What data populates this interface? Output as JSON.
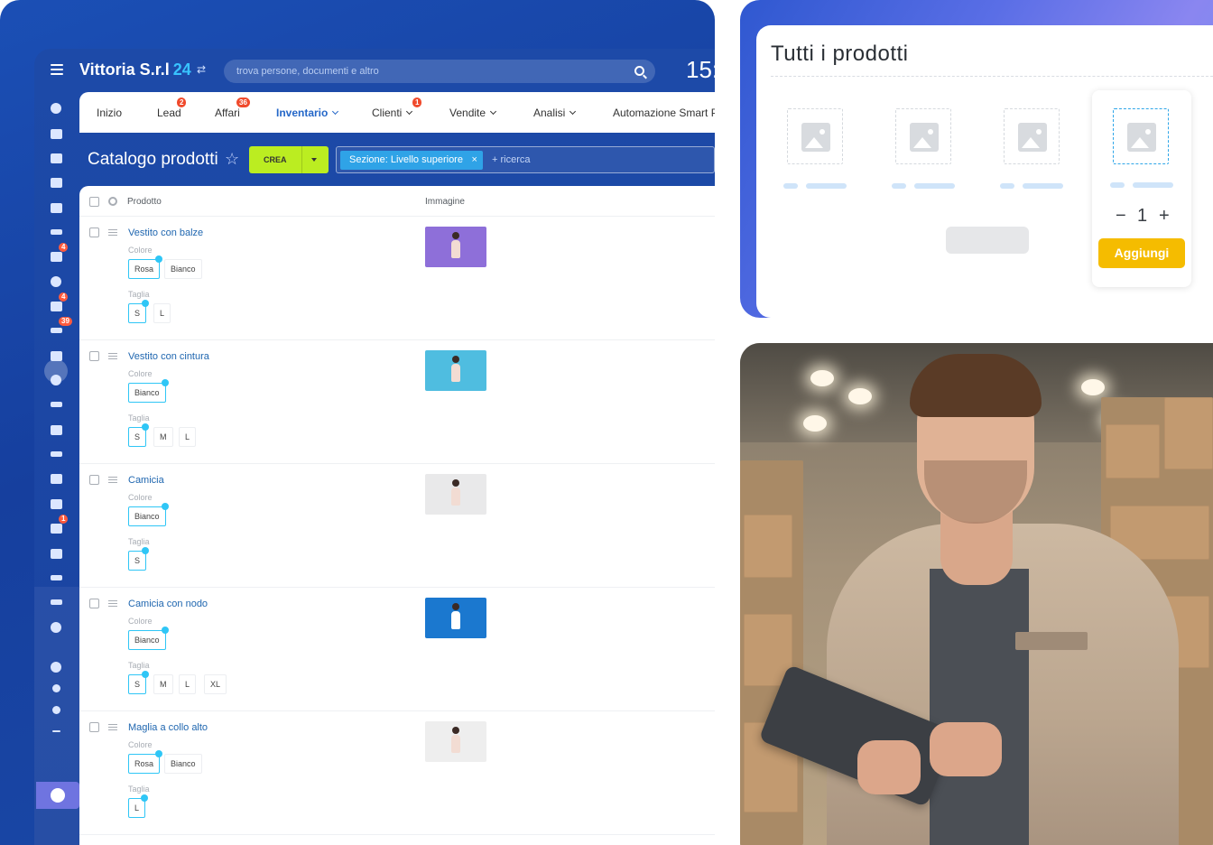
{
  "app": {
    "brand_name": "Vittoria S.r.l",
    "brand_number": "24",
    "brand_toggle": "⇄",
    "search_placeholder": "trova persone, documenti e altro",
    "clock": "15:"
  },
  "sidebar": {
    "icons": [
      "funnel-icon",
      "feed-icon",
      "chat-icon",
      "calendar-icon",
      "document-icon",
      "drive-icon",
      "mail-icon",
      "group-icon",
      "task-icon",
      "crm-filter-icon",
      "store-icon",
      "target-icon",
      "cart-icon",
      "edit-icon",
      "sign-icon",
      "chart-icon",
      "contact-card-icon",
      "robot-icon",
      "box-icon",
      "stream-icon",
      "code-icon",
      "more-icon",
      "help-icon",
      "network-icon",
      "settings-icon",
      "plus-icon",
      "crown-icon"
    ],
    "badges": {
      "mail": "4",
      "task": "4",
      "crm_filter": "39",
      "robot": "1"
    }
  },
  "tabs": [
    {
      "label": "Inizio",
      "badge": ""
    },
    {
      "label": "Lead",
      "badge": "2"
    },
    {
      "label": "Affari",
      "badge": "36"
    },
    {
      "label": "Inventario",
      "badge": "",
      "active": true
    },
    {
      "label": "Clienti",
      "badge": "1"
    },
    {
      "label": "Vendite",
      "badge": ""
    },
    {
      "label": "Analisi",
      "badge": ""
    },
    {
      "label": "Automazione Smart P",
      "badge": ""
    }
  ],
  "section": {
    "title": "Catalogo prodotti",
    "create_label": "CREA",
    "filter_tag": "Sezione: Livello superiore",
    "filter_remove": "×",
    "filter_add": "+ ricerca"
  },
  "table": {
    "columns": [
      "Prodotto",
      "Immagine"
    ],
    "color_label": "Colore",
    "size_label": "Taglia",
    "rows": [
      {
        "name": "Vestito con balze",
        "colors": [
          {
            "v": "Rosa",
            "sel": true
          },
          {
            "v": "Bianco",
            "sel": false
          }
        ],
        "sizes": [
          {
            "v": "S",
            "sel": true
          },
          {
            "v": "L",
            "sel": false
          }
        ],
        "thumb_bg": "#8e6fd9"
      },
      {
        "name": "Vestito con cintura",
        "colors": [
          {
            "v": "Bianco",
            "sel": true
          }
        ],
        "sizes": [
          {
            "v": "S",
            "sel": true
          },
          {
            "v": "M",
            "sel": false
          },
          {
            "v": "L",
            "sel": false
          }
        ],
        "thumb_bg": "#4fbde0"
      },
      {
        "name": "Camicia",
        "colors": [
          {
            "v": "Bianco",
            "sel": true
          }
        ],
        "sizes": [
          {
            "v": "S",
            "sel": true
          }
        ],
        "thumb_bg": "#e9e9ea"
      },
      {
        "name": "Camicia con nodo",
        "colors": [
          {
            "v": "Bianco",
            "sel": true
          }
        ],
        "sizes": [
          {
            "v": "S",
            "sel": true
          },
          {
            "v": "M",
            "sel": false
          },
          {
            "v": "L",
            "sel": false
          },
          {
            "v": "XL",
            "sel": false
          }
        ],
        "thumb_bg": "#1b78cf"
      },
      {
        "name": "Maglia a collo alto",
        "colors": [
          {
            "v": "Rosa",
            "sel": true
          },
          {
            "v": "Bianco",
            "sel": false
          }
        ],
        "sizes": [
          {
            "v": "L",
            "sel": true
          }
        ],
        "thumb_bg": "#eeeeee"
      }
    ]
  },
  "product_card": {
    "title": "Tutti i prodotti",
    "quantity": "1",
    "minus": "−",
    "plus": "+",
    "add_label": "Aggiungi"
  },
  "colors": {
    "accent_blue": "#2067b0",
    "crea_green": "#bbed21",
    "filter_tag_blue": "#2fa3e7",
    "badge_red": "#f04a2c",
    "add_yellow": "#f5bc00"
  }
}
